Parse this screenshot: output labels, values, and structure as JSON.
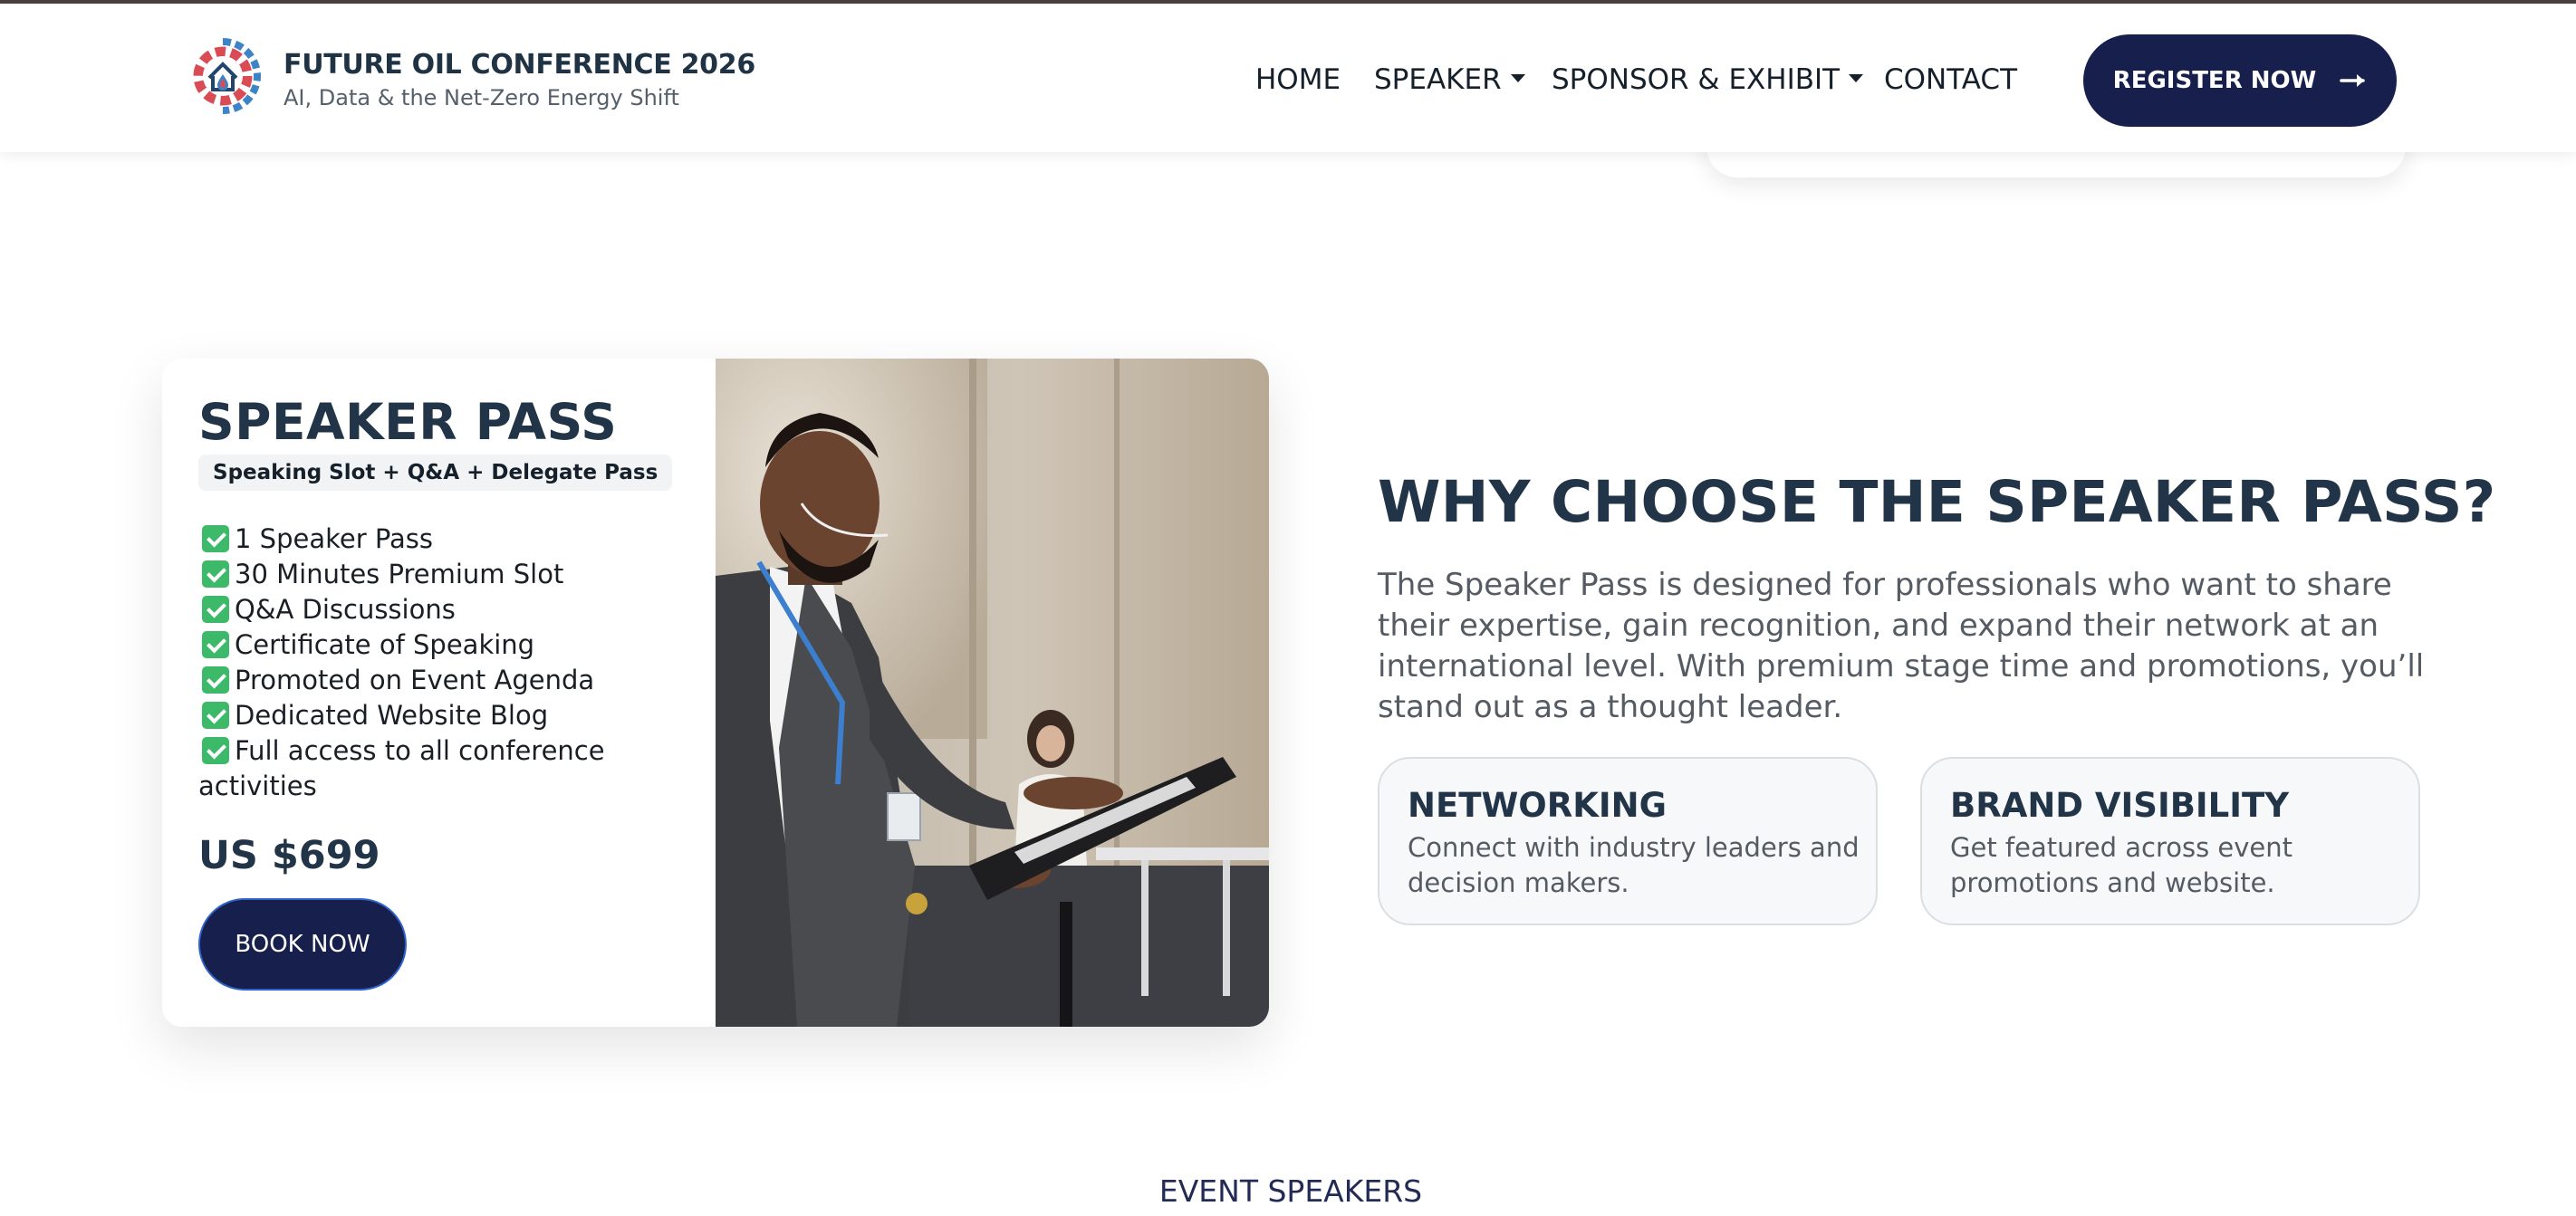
{
  "brand": {
    "title": "FUTURE OIL CONFERENCE 2026",
    "subtitle": "AI, Data & the Net-Zero Energy Shift",
    "logo_icon": "gear-house-drop-icon"
  },
  "nav": {
    "items": [
      {
        "label": "HOME",
        "dropdown": false
      },
      {
        "label": "SPEAKER",
        "dropdown": true
      },
      {
        "label": "SPONSOR & EXHIBIT",
        "dropdown": true
      },
      {
        "label": "CONTACT",
        "dropdown": false
      }
    ],
    "register_label": "REGISTER NOW",
    "register_icon": "arrow-right-icon"
  },
  "pass": {
    "title": "SPEAKER PASS",
    "tag": "Speaking Slot + Q&A + Delegate Pass",
    "features": [
      "1 Speaker Pass",
      "30 Minutes Premium Slot",
      "Q&A Discussions",
      "Certificate of Speaking",
      "Promoted on Event Agenda",
      "Dedicated Website Blog",
      "Full access to all conference",
      "activities"
    ],
    "price": "US $699",
    "book_label": "BOOK NOW"
  },
  "why": {
    "title": "WHY CHOOSE THE SPEAKER PASS?",
    "text": "The Speaker Pass is designed for professionals who want to share their expertise, gain recognition, and expand their network at an international level. With premium stage time and promotions, you’ll stand out as a thought leader.",
    "benefits": [
      {
        "title": "NETWORKING",
        "text": "Connect with industry leaders and decision makers."
      },
      {
        "title": "BRAND VISIBILITY",
        "text": "Get featured across event promotions and website."
      }
    ]
  },
  "next_section": "EVENT SPEAKERS",
  "colors": {
    "navy": "#171f4d",
    "heading": "#223447",
    "check_green": "#3cba6a"
  }
}
